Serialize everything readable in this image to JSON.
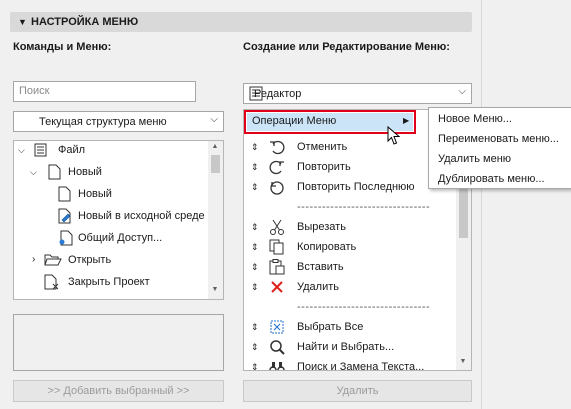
{
  "section": {
    "title": "НАСТРОЙКА МЕНЮ"
  },
  "left": {
    "label": "Команды и Меню:",
    "search_placeholder": "Поиск",
    "structure_select": "Текущая структура меню",
    "tree": [
      {
        "label": "Файл",
        "icon": "menu-icon"
      },
      {
        "label": "Новый",
        "icon": "document-icon"
      },
      {
        "label": "Новый",
        "icon": "document-icon"
      },
      {
        "label": "Новый в исходной среде",
        "icon": "document-pencil-icon"
      },
      {
        "label": "Общий Доступ...",
        "icon": "document-share-icon"
      },
      {
        "label": "Открыть",
        "icon": "folder-open-icon"
      },
      {
        "label": "Закрыть Проект",
        "icon": "document-close-icon"
      }
    ],
    "add_button": ">> Добавить выбранный >>"
  },
  "right": {
    "label": "Создание или Редактирование Меню:",
    "editor_select": "Редактор",
    "selected_item": "Операции Меню",
    "items": [
      {
        "type": "item",
        "label": "Отменить",
        "icon": "undo-icon"
      },
      {
        "type": "item",
        "label": "Повторить",
        "icon": "redo-icon"
      },
      {
        "type": "item",
        "label": "Повторить Последнюю",
        "icon": "repeat-icon"
      },
      {
        "type": "separator",
        "label": "--------------------------------"
      },
      {
        "type": "item",
        "label": "Вырезать",
        "icon": "scissors-icon"
      },
      {
        "type": "item",
        "label": "Копировать",
        "icon": "copy-icon"
      },
      {
        "type": "item",
        "label": "Вставить",
        "icon": "paste-icon"
      },
      {
        "type": "item",
        "label": "Удалить",
        "icon": "delete-x-icon"
      },
      {
        "type": "separator",
        "label": "--------------------------------"
      },
      {
        "type": "item",
        "label": "Выбрать Все",
        "icon": "select-all-icon"
      },
      {
        "type": "item",
        "label": "Найти и Выбрать...",
        "icon": "find-select-icon"
      },
      {
        "type": "item",
        "label": "Поиск и Замена Текста...",
        "icon": "binoculars-icon"
      }
    ],
    "delete_button": "Удалить"
  },
  "context_menu": {
    "items": [
      "Новое Меню...",
      "Переименовать меню...",
      "Удалить меню",
      "Дублировать меню..."
    ]
  },
  "colors": {
    "highlight_fill": "#cce4f7",
    "highlight_border": "#e0001b",
    "accent_blue": "#1f6fd1"
  }
}
